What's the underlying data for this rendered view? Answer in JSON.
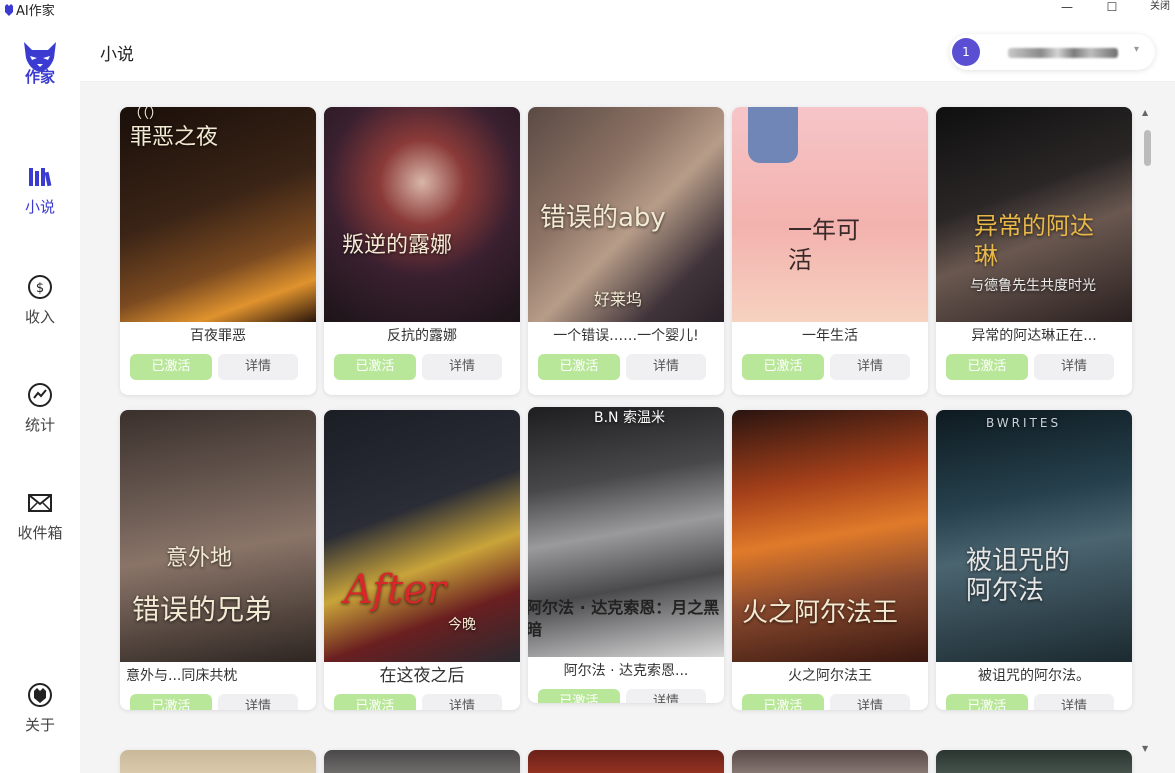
{
  "window": {
    "title": "AI作家",
    "close_label": "关闭",
    "minimize_glyph": "—",
    "maximize_glyph": "☐"
  },
  "brand": {
    "logo_text": "作家",
    "accent": "#3b3bd1"
  },
  "sidebar": {
    "items": [
      {
        "label": "小说",
        "icon": "books-icon",
        "active": true
      },
      {
        "label": "收入",
        "icon": "dollar-icon",
        "active": false
      },
      {
        "label": "统计",
        "icon": "chart-icon",
        "active": false
      },
      {
        "label": "收件箱",
        "icon": "mail-icon",
        "active": false
      },
      {
        "label": "关于",
        "icon": "about-icon",
        "active": false
      }
    ]
  },
  "header": {
    "page_title": "小说",
    "user_badge": "1"
  },
  "novels": [
    {
      "title": "百夜罪恶",
      "cover_text": "罪恶之夜",
      "cover_top": "（（）",
      "active_label": "已激活",
      "detail_label": "详情",
      "colors": [
        "#2a1a12",
        "#6b3a1c",
        "#d98a2b"
      ]
    },
    {
      "title": "反抗的露娜",
      "cover_text": "叛逆的露娜",
      "active_label": "已激活",
      "detail_label": "详情",
      "colors": [
        "#3a2030",
        "#7a1f25",
        "#c94a3a"
      ]
    },
    {
      "title": "一个错误……一个婴儿!",
      "cover_text": "错误的aby",
      "cover_sub": "好莱坞",
      "active_label": "已激活",
      "detail_label": "详情",
      "colors": [
        "#3d3a40",
        "#7a6058",
        "#b09a88"
      ]
    },
    {
      "title": "一年生活",
      "cover_text": "一年可活",
      "active_label": "已激活",
      "detail_label": "详情",
      "colors": [
        "#f7c9c9",
        "#f4b6b0",
        "#f7d3c6"
      ]
    },
    {
      "title": "异常的阿达琳正在...",
      "cover_text": "异常的阿达琳",
      "cover_sub": "与德鲁先生共度时光",
      "active_label": "已激活",
      "detail_label": "详情",
      "colors": [
        "#1a1a1c",
        "#3a3030",
        "#6a5a50"
      ]
    },
    {
      "title": "意外与...同床共枕",
      "cover_text": "意外地",
      "cover_sub": "错误的兄弟",
      "active_label": "已激活",
      "detail_label": "详情",
      "colors": [
        "#2e2624",
        "#5a4a44",
        "#8a7a70"
      ]
    },
    {
      "title": "在这夜之后",
      "cover_text": "After",
      "cover_sub": "今晚",
      "active_label": "已激活",
      "detail_label": "详情",
      "colors": [
        "#1b1d24",
        "#6a1f20",
        "#c9a43a"
      ]
    },
    {
      "title": "阿尔法 · 达克索恩...",
      "cover_text": "阿尔法 · 达克索恩：月之黑暗",
      "cover_top": "B.N 索温米",
      "active_label": "已激活",
      "detail_label": "详情",
      "colors": [
        "#2a2a2c",
        "#5a5a5c",
        "#a9a9aa"
      ]
    },
    {
      "title": "火之阿尔法王",
      "cover_text": "火之阿尔法王",
      "active_label": "已激活",
      "detail_label": "详情",
      "colors": [
        "#3a1810",
        "#a5401a",
        "#e07a2a"
      ]
    },
    {
      "title": "被诅咒的阿尔法。",
      "cover_text": "被诅咒的阿尔法",
      "cover_top": "BWRITES",
      "active_label": "已激活",
      "detail_label": "详情",
      "colors": [
        "#13222a",
        "#2c4450",
        "#4a6470"
      ]
    }
  ]
}
